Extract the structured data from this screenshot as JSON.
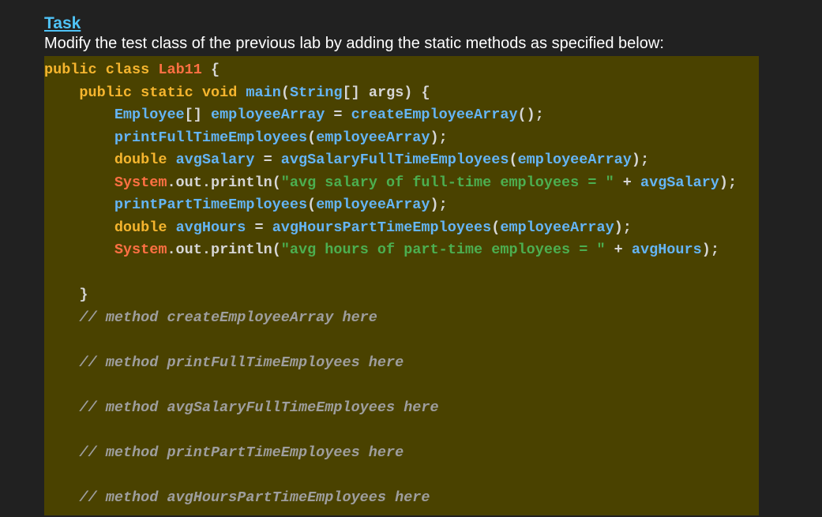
{
  "heading": "Task",
  "description": "Modify the test class of the previous lab by adding the static methods as specified below:",
  "code": {
    "line1": {
      "kw1": "public",
      "kw2": "class",
      "cls": "Lab11",
      "brace": " {"
    },
    "line2": {
      "kw1": "public",
      "kw2": "static",
      "kw3": "void",
      "mth": "main",
      "p1": "(",
      "typ": "String",
      "p2": "[] args) {"
    },
    "line3": {
      "typ": "Employee",
      "p1": "[] ",
      "var": "employeeArray",
      "p2": " = ",
      "mth": "createEmployeeArray",
      "p3": "();"
    },
    "line4": {
      "mth": "printFullTimeEmployees",
      "p1": "(",
      "var": "employeeArray",
      "p2": ");"
    },
    "line5": {
      "kw": "double",
      "var1": "avgSalary",
      "p1": " = ",
      "mth": "avgSalaryFullTimeEmployees",
      "p2": "(",
      "var2": "employeeArray",
      "p3": ");"
    },
    "line6": {
      "cls": "System",
      "out": ".out.println",
      "p1": "(",
      "str": "\"avg salary of full-time employees = \"",
      "p2": " + ",
      "var": "avgSalary",
      "p3": ");"
    },
    "line7": {
      "mth": "printPartTimeEmployees",
      "p1": "(",
      "var": "employeeArray",
      "p2": ");"
    },
    "line8": {
      "kw": "double",
      "var1": "avgHours",
      "p1": " = ",
      "mth": "avgHoursPartTimeEmployees",
      "p2": "(",
      "var2": "employeeArray",
      "p3": ");"
    },
    "line9": {
      "cls": "System",
      "out": ".out.println",
      "p1": "(",
      "str": "\"avg hours of part-time employees = \"",
      "p2": " + ",
      "var": "avgHours",
      "p3": ");"
    },
    "line11": {
      "brace": "}"
    },
    "cmt1": "// method createEmployeeArray here",
    "cmt2": "// method printFullTimeEmployees here",
    "cmt3": "// method avgSalaryFullTimeEmployees here",
    "cmt4": "// method printPartTimeEmployees here",
    "cmt5": "// method avgHoursPartTimeEmployees here"
  }
}
